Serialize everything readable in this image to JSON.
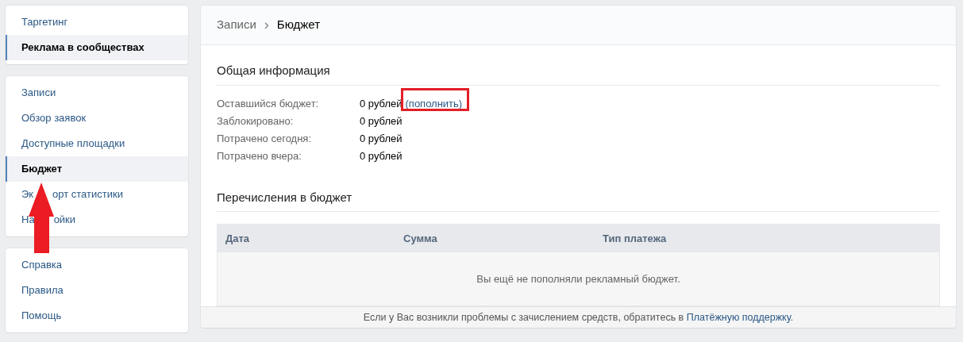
{
  "sidebar": {
    "groups": [
      {
        "items": [
          {
            "label": "Таргетинг",
            "selected": false
          },
          {
            "label": "Реклама в сообществах",
            "selected": true
          }
        ]
      },
      {
        "items": [
          {
            "label": "Записи",
            "selected": false
          },
          {
            "label": "Обзор заявок",
            "selected": false
          },
          {
            "label": "Доступные площадки",
            "selected": false
          },
          {
            "label": "Бюджет",
            "selected": true
          },
          {
            "label_parts": [
              "Эк",
              "орт статистики"
            ],
            "selected": false
          },
          {
            "label_parts": [
              "На",
              "ойки"
            ],
            "selected": false
          }
        ]
      },
      {
        "items": [
          {
            "label": "Справка",
            "selected": false
          },
          {
            "label": "Правила",
            "selected": false
          },
          {
            "label": "Помощь",
            "selected": false
          }
        ]
      }
    ]
  },
  "breadcrumb": {
    "items": [
      "Записи",
      "Бюджет"
    ],
    "separator": "›"
  },
  "general_info": {
    "title": "Общая информация",
    "rows": [
      {
        "label": "Оставшийся бюджет:",
        "value": "0 рублей",
        "link": "(пополнить)"
      },
      {
        "label": "Заблокировано:",
        "value": "0 рублей"
      },
      {
        "label": "Потрачено сегодня:",
        "value": "0 рублей"
      },
      {
        "label": "Потрачено вчера:",
        "value": "0 рублей"
      }
    ]
  },
  "transfers": {
    "title": "Перечисления в бюджет",
    "table": {
      "columns": [
        "Дата",
        "Сумма",
        "Тип платежа"
      ],
      "empty_message": "Вы ещё не пополняли рекламный бюджет."
    }
  },
  "footer": {
    "text": "Если у Вас возникли проблемы с зачислением средств, обратитесь в ",
    "link": "Платёжную поддержку",
    "end": "."
  },
  "annotations": {
    "highlight_frame": true,
    "arrow": true
  }
}
